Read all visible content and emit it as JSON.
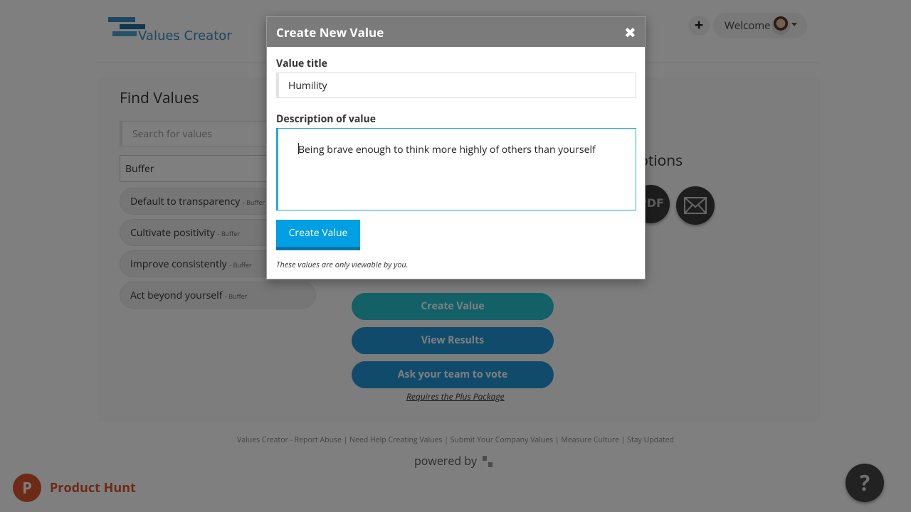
{
  "header": {
    "logo_text": "Values Creator",
    "plus_label": "+",
    "welcome_label": "Welcome"
  },
  "find": {
    "title": "Find Values",
    "search_placeholder": "Search for values",
    "filter_value": "Buffer",
    "values": [
      {
        "name": "Default to transparency",
        "source": "- Buffer"
      },
      {
        "name": "Cultivate positivity",
        "source": "- Buffer"
      },
      {
        "name": "Improve consistently",
        "source": "- Buffer"
      },
      {
        "name": "Act beyond yourself",
        "source": "- Buffer"
      }
    ]
  },
  "options": {
    "title_partial": "ptions",
    "pdf_label": "PDF"
  },
  "actions": {
    "create_value": "Create Value",
    "view_results": "View Results",
    "ask_team": "Ask your team to vote",
    "requires": "Requires the Plus Package"
  },
  "footer": {
    "links": "Values Creator - Report Abuse | Need Help Creating Values | Submit Your Company Values | Measure Culture | Stay Updated",
    "powered_by": "powered by",
    "product_hunt": "Product Hunt",
    "help": "?"
  },
  "modal": {
    "title": "Create New Value",
    "close": "✖",
    "value_title_label": "Value title",
    "value_title": "Humility",
    "description_label": "Description of value",
    "description": "Being brave enough to think more highly of others than yourself",
    "create_button": "Create Value",
    "note": "These values are only viewable by you."
  },
  "colors": {
    "accent": "#009fe3",
    "teal_button": "#27c1cf",
    "blue_button": "#2397d6",
    "product_hunt": "#da552f",
    "modal_header": "#7b7b7b"
  }
}
